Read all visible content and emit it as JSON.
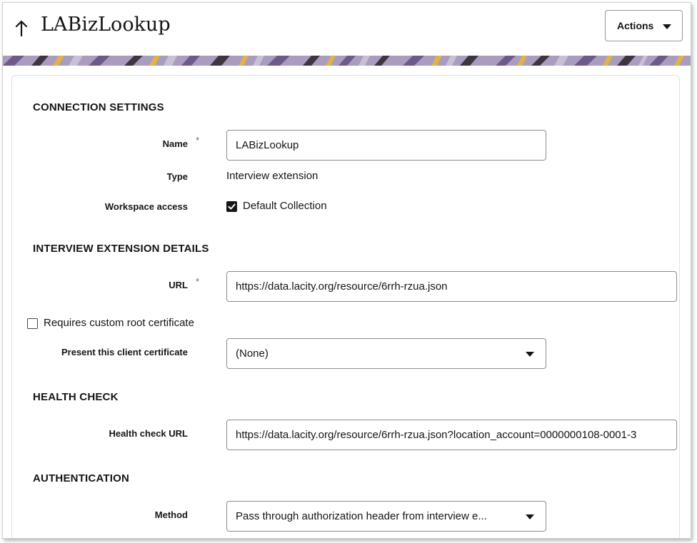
{
  "header": {
    "title": "LABizLookup",
    "actions_label": "Actions",
    "back_icon": "up-arrow-icon"
  },
  "theme": {
    "banner_colors": [
      "#a99cbe",
      "#6e5a8a",
      "#3d3540",
      "#e0b24a",
      "#c8c0d6"
    ]
  },
  "connection_settings": {
    "title": "CONNECTION SETTINGS",
    "name_label": "Name",
    "name_required": "*",
    "name_value": "LABizLookup",
    "type_label": "Type",
    "type_value": "Interview extension",
    "workspace_label": "Workspace access",
    "workspace_option": "Default Collection",
    "workspace_checked": true
  },
  "interview_extension": {
    "title": "INTERVIEW EXTENSION DETAILS",
    "url_label": "URL",
    "url_required": "*",
    "url_value": "https://data.lacity.org/resource/6rrh-rzua.json",
    "root_cert_label": "Requires custom root certificate",
    "root_cert_checked": false,
    "client_cert_label": "Present this client certificate",
    "client_cert_value": "(None)"
  },
  "health_check": {
    "title": "HEALTH CHECK",
    "url_label": "Health check URL",
    "url_value": "https://data.lacity.org/resource/6rrh-rzua.json?location_account=0000000108-0001-3"
  },
  "authentication": {
    "title": "AUTHENTICATION",
    "method_label": "Method",
    "method_value": "Pass through authorization header from interview e..."
  }
}
